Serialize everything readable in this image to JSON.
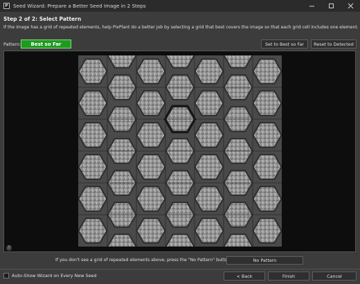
{
  "window": {
    "app_icon_letter": "P",
    "title": "Seed Wizard: Prepare a Better Seed Image in 2 Steps",
    "controls": {
      "minimize": "minimize-icon",
      "maximize": "maximize-icon",
      "close": "close-icon"
    }
  },
  "step": {
    "title": "Step 2 of 2: Select Pattern",
    "description": "If the image has a grid of repeated elements, help PixPlant do a better job by selecting a grid that best covers the image so that each grid cell includes one element."
  },
  "pattern": {
    "label": "Pattern:",
    "selected": "Best so Far",
    "selected_color": "#1f9a1f",
    "set_best_button": "Set to Best so Far",
    "reset_button": "Reset to Detected"
  },
  "preview": {
    "help_icon": "?",
    "grid_color": "#2a2a2a",
    "texture_color": "#8e8e8e"
  },
  "no_pattern": {
    "text": "If you don't see a grid of repeated elements above, press the \"No Pattern\" button:",
    "button": "No Pattern"
  },
  "footer": {
    "auto_show_label": "Auto-Show Wizard on Every New Seed",
    "auto_show_checked": false,
    "back_button": "< Back",
    "finish_button": "Finish",
    "cancel_button": "Cancel"
  }
}
